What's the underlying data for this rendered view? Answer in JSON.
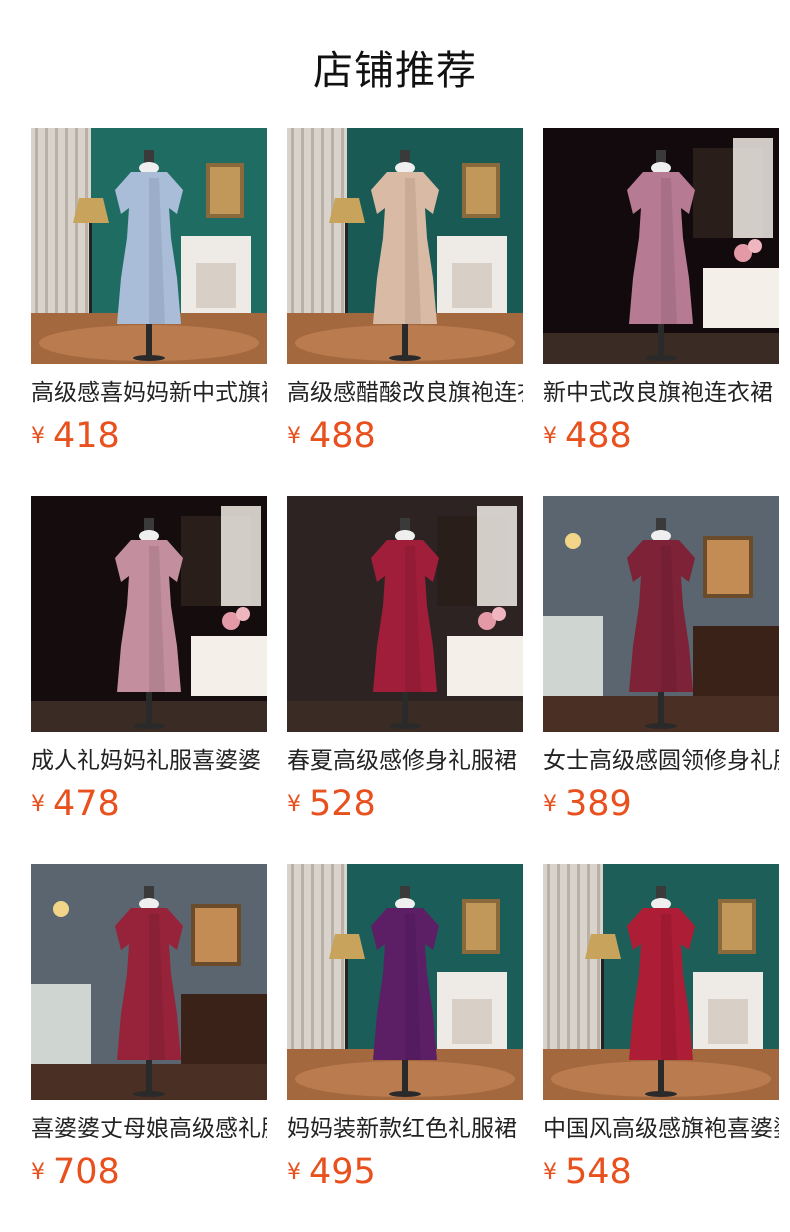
{
  "page_title": "店铺推荐",
  "colors": {
    "price": "#e8501e",
    "title": "#111111"
  },
  "products": [
    {
      "name": "高级感喜妈妈新中式旗袍",
      "currency": "¥",
      "price": "418",
      "image": "light-blue-qipao-on-mannequin",
      "dress": "#a9bcd8",
      "bg": "#1f6c63",
      "scene": "room"
    },
    {
      "name": "高级感醋酸改良旗袍连衣裙",
      "currency": "¥",
      "price": "488",
      "image": "beige-dress-on-mannequin",
      "dress": "#d9bba5",
      "bg": "#1a5a55",
      "scene": "room"
    },
    {
      "name": "新中式改良旗袍连衣裙",
      "currency": "¥",
      "price": "488",
      "image": "pink-jacquard-dress-on-mannequin",
      "dress": "#b77a93",
      "bg": "#120a0c",
      "scene": "dark"
    },
    {
      "name": "成人礼妈妈礼服喜婆婆",
      "currency": "¥",
      "price": "478",
      "image": "pink-floral-dress-on-mannequin",
      "dress": "#c38e9d",
      "bg": "#140c0d",
      "scene": "dark"
    },
    {
      "name": "春夏高级感修身礼服裙",
      "currency": "¥",
      "price": "528",
      "image": "red-mermaid-dress-on-mannequin",
      "dress": "#a01e3a",
      "bg": "#2d2322",
      "scene": "dark"
    },
    {
      "name": "女士高级感圆领修身礼服",
      "currency": "¥",
      "price": "389",
      "image": "burgundy-sequin-dress-on-mannequin",
      "dress": "#7e2238",
      "bg": "#4c5560",
      "scene": "lounge"
    },
    {
      "name": "喜婆婆丈母娘高级感礼服",
      "currency": "¥",
      "price": "708",
      "image": "red-embroidered-dress-on-mannequin",
      "dress": "#96233a",
      "bg": "#4f5b66",
      "scene": "lounge"
    },
    {
      "name": "妈妈装新款红色礼服裙",
      "currency": "¥",
      "price": "495",
      "image": "purple-beaded-qipao-on-mannequin",
      "dress": "#5c1f66",
      "bg": "#1b5d58",
      "scene": "room"
    },
    {
      "name": "中国风高级感旗袍喜婆婆",
      "currency": "¥",
      "price": "548",
      "image": "red-embroidered-mermaid-dress-on-mannequin",
      "dress": "#ad1d35",
      "bg": "#1e5e58",
      "scene": "room"
    }
  ]
}
